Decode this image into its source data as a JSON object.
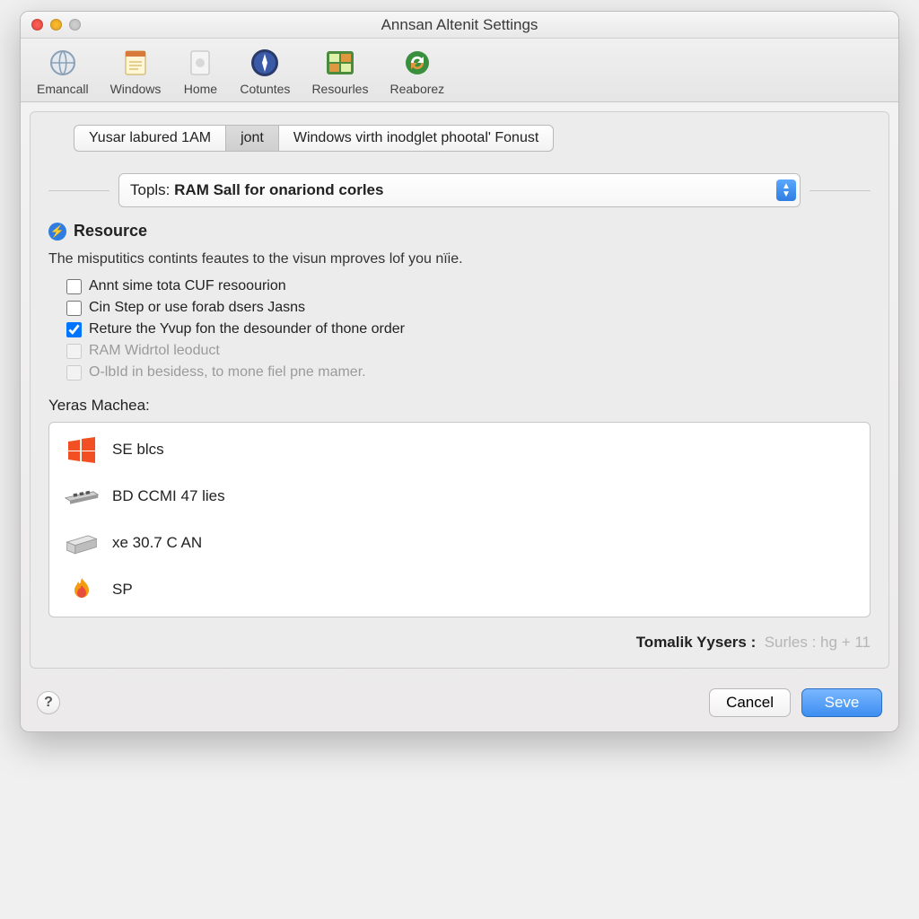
{
  "window": {
    "title": "Annsan Altenit Settings"
  },
  "toolbar": [
    {
      "id": "emancall",
      "label": "Emancall"
    },
    {
      "id": "windows",
      "label": "Windows"
    },
    {
      "id": "home",
      "label": "Home"
    },
    {
      "id": "cotuntes",
      "label": "Cotuntes"
    },
    {
      "id": "resourles",
      "label": "Resourles"
    },
    {
      "id": "reaborez",
      "label": "Reaborez"
    }
  ],
  "tabs": [
    {
      "label": "Yusar labured 1AM",
      "active": false
    },
    {
      "label": "jont",
      "active": true
    },
    {
      "label": "Windows virth inodglet phootal' Fonust",
      "active": false
    }
  ],
  "popup": {
    "prefix": "Topls:",
    "value": "RAM Sall for onariond corles"
  },
  "section": {
    "title": "Resource",
    "description": "The misputitics contints feautes to the visun mproves lof you nïie."
  },
  "checkboxes": [
    {
      "label": "Annt sime tota CUF resoourion",
      "checked": false,
      "disabled": false
    },
    {
      "label": "Cin Step or use forab dsers Jasns",
      "checked": false,
      "disabled": false
    },
    {
      "label": "Reture the Yvup fon the desounder of thone order",
      "checked": true,
      "disabled": false
    },
    {
      "label": "RAM Widrtol leoduct",
      "checked": false,
      "disabled": true
    },
    {
      "label": "O-lbId in besidess, to mone fiel pne mamer.",
      "checked": false,
      "disabled": true
    }
  ],
  "list": {
    "heading": "Yeras Machea:",
    "items": [
      {
        "icon": "windows-icon",
        "label": "SE blcs"
      },
      {
        "icon": "ram-icon",
        "label": "BD CCMI 47 lies"
      },
      {
        "icon": "package-icon",
        "label": "xe 30.7 C AN"
      },
      {
        "icon": "flame-icon",
        "label": "SP"
      }
    ]
  },
  "footer": {
    "label": "Tomalik Yysers :",
    "value": "Surles : hg + 11"
  },
  "buttons": {
    "help": "?",
    "cancel": "Cancel",
    "save": "Seve"
  }
}
